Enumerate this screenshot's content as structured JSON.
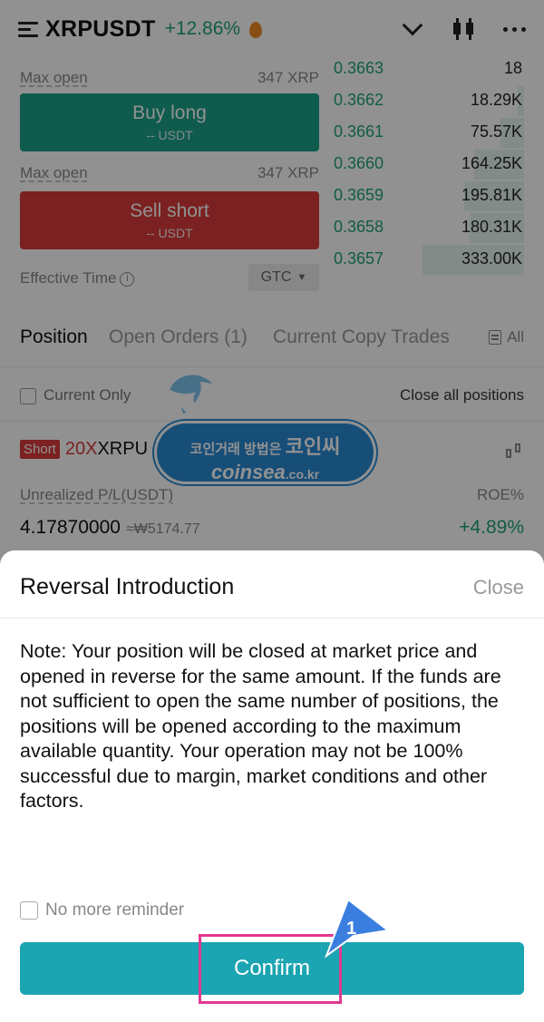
{
  "header": {
    "pair": "XRPUSDT",
    "change": "+12.86%"
  },
  "trade": {
    "max_open_label": "Max open",
    "buy_max": "347 XRP",
    "sell_max": "347 XRP",
    "buy_label": "Buy long",
    "buy_sub": "-- USDT",
    "sell_label": "Sell short",
    "sell_sub": "-- USDT",
    "effective_time_label": "Effective Time",
    "effective_time_value": "GTC"
  },
  "orderbook": {
    "rows": [
      {
        "price": "0.3663",
        "qty": "18",
        "depth": 0.0
      },
      {
        "price": "0.3662",
        "qty": "18.29K",
        "depth": 0.06
      },
      {
        "price": "0.3661",
        "qty": "75.57K",
        "depth": 0.23
      },
      {
        "price": "0.3660",
        "qty": "164.25K",
        "depth": 0.49
      },
      {
        "price": "0.3659",
        "qty": "195.81K",
        "depth": 0.59
      },
      {
        "price": "0.3658",
        "qty": "180.31K",
        "depth": 0.54
      },
      {
        "price": "0.3657",
        "qty": "333.00K",
        "depth": 1.0
      }
    ]
  },
  "positions": {
    "tabs": [
      "Position",
      "Open Orders (1)",
      "Current Copy Trades"
    ],
    "all_label": "All",
    "current_only": "Current Only",
    "close_all": "Close all positions",
    "side": "Short",
    "leverage": "20X",
    "symbol": "XRPU",
    "unrealized_label": "Unrealized P/L(USDT)",
    "roe_label": "ROE%",
    "pnl_value": "4.17870000",
    "pnl_krw": "≈₩5174.77",
    "roe_value": "+4.89%"
  },
  "watermark": {
    "ko_prefix": "코인거래 방법은",
    "ko_brand": "코인씨",
    "en_brand": "coinsea",
    "en_suffix": ".co.kr"
  },
  "dialog": {
    "title": "Reversal Introduction",
    "close": "Close",
    "note": "Note: Your position will be closed at market price and opened in reverse for the same amount. If the funds are not sufficient to open the same number of positions, the positions will be opened according to the maximum available quantity. Your operation may not be 100% successful due to margin, market conditions and other factors.",
    "no_reminder": "No more reminder",
    "confirm": "Confirm",
    "step_number": "1"
  },
  "colors": {
    "green": "#1fa37d",
    "red": "#d93a3a",
    "teal": "#1ba4b1",
    "highlight": "#e2398f",
    "watermark_blue": "#2a8ad4"
  }
}
